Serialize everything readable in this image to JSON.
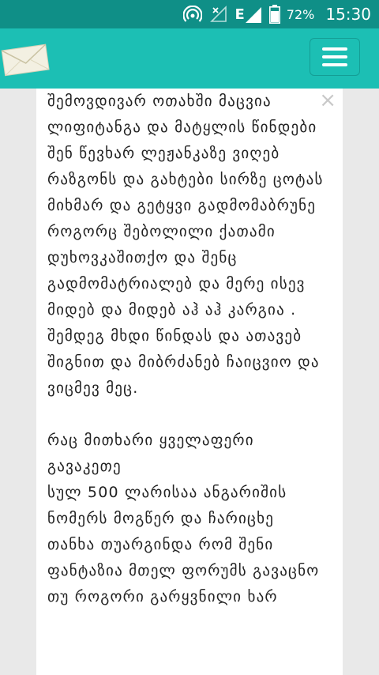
{
  "status_bar": {
    "battery_percent": "72%",
    "time": "15:30",
    "network_label": "E"
  },
  "colors": {
    "status_bar_bg": "#0f8f87",
    "app_bar_bg": "#1cbfb4",
    "page_bg": "#e9e9e9"
  },
  "post": {
    "paragraph1": "შემოვდივარ ოთახში მაცვია ლიფიტანგა და მატყლის წინდები შენ წევხარ ლეჟანკაზე ვიღებ რაზგონს და გახტები სირზე ცოტას მიხმარ და გეტყვი გადმომაბრუნე როგორც შებოლილი ქათამი დუხოვკაშითქო და შენც გადმომატრიალებ და მერე ისევ მიდებ და მიდებ აჰ აჰ კარგია . შემდეგ მხდი წინდას და ათავებ შიგნით და მიბრძანებ ჩაიცვიო და ვიცმევ მეც.",
    "line2": "რაც მითხარი ყველაფერი გავაკეთე",
    "line3": "სულ 500 ლარისაა ანგარიშის ნომერს მოგწერ და ჩარიცხე თანხა თუარგინდა რომ შენი ფანტაზია მთელ ფორუმს გავაცნო თუ როგორი გარყვნილი ხარ"
  }
}
